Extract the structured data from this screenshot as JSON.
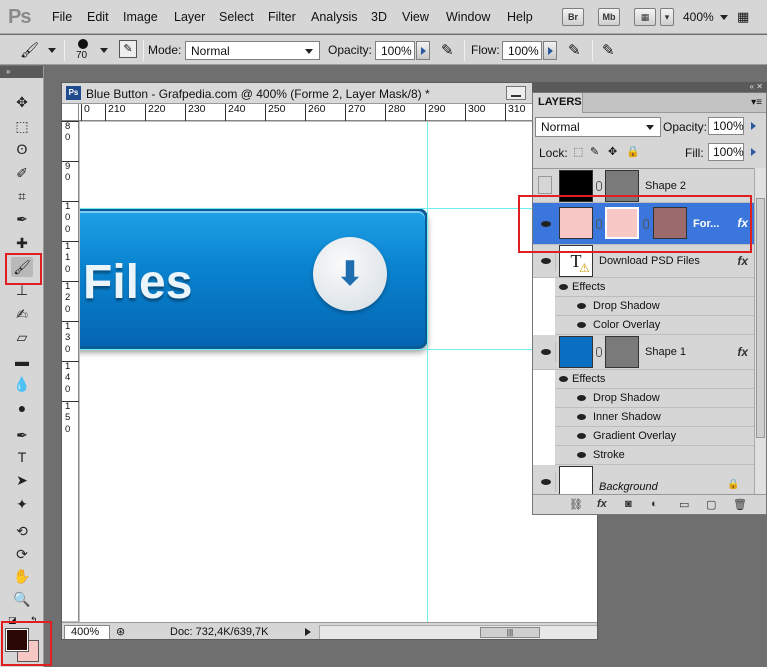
{
  "app": {
    "logo": "Ps"
  },
  "menu": [
    "File",
    "Edit",
    "Image",
    "Layer",
    "Select",
    "Filter",
    "Analysis",
    "3D",
    "View",
    "Window",
    "Help"
  ],
  "top_icons": [
    "Br",
    "Mb"
  ],
  "zoom_readout": "400%",
  "options": {
    "brush_size": "70",
    "mode_label": "Mode:",
    "mode_value": "Normal",
    "opacity_label": "Opacity:",
    "opacity_value": "100%",
    "flow_label": "Flow:",
    "flow_value": "100%"
  },
  "document": {
    "title": "Blue Button - Grafpedia.com @ 400% (Forme 2, Layer Mask/8) *",
    "ruler_top": [
      "0",
      "210",
      "220",
      "230",
      "240",
      "250",
      "260",
      "270",
      "280",
      "290",
      "300",
      "310"
    ],
    "ruler_left": [
      "8",
      "0",
      "9",
      "0",
      "1",
      "0",
      "0",
      "1",
      "1",
      "0",
      "1",
      "2",
      "0",
      "1",
      "3",
      "0",
      "1",
      "4",
      "0",
      "1",
      "5",
      "0"
    ],
    "button_label": "Files",
    "status_zoom": "400%",
    "status_doc": "Doc: 732,4K/639,7K"
  },
  "layers": {
    "tab": "LAYERS",
    "blend_mode": "Normal",
    "opacity_label": "Opacity:",
    "opacity_value": "100%",
    "lock_label": "Lock:",
    "fill_label": "Fill:",
    "fill_value": "100%",
    "items": [
      {
        "name": "Shape 2"
      },
      {
        "name": "For..."
      },
      {
        "name": "Download PSD Files"
      },
      {
        "name": "Shape 1"
      },
      {
        "name": "Background"
      }
    ],
    "effects_label": "Effects",
    "text_effects": [
      "Drop Shadow",
      "Color Overlay"
    ],
    "shape1_effects": [
      "Drop Shadow",
      "Inner Shadow",
      "Gradient Overlay",
      "Stroke"
    ]
  },
  "colors": {
    "foreground": "#2b0806",
    "background": "#f7c7c5",
    "button_blue": "#0a84d0",
    "highlight_red": "#e02020",
    "selected_layer": "#3b76dc"
  }
}
